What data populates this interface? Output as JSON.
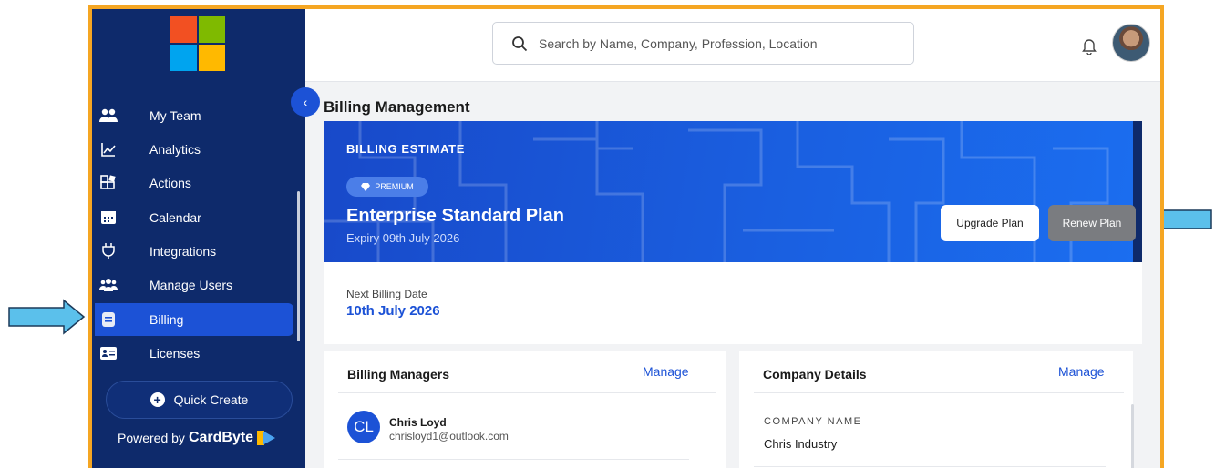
{
  "sidebar": {
    "items": [
      {
        "label": "My Team",
        "icon": "team-icon"
      },
      {
        "label": "Analytics",
        "icon": "analytics-icon"
      },
      {
        "label": "Actions",
        "icon": "actions-icon"
      },
      {
        "label": "Calendar",
        "icon": "calendar-icon"
      },
      {
        "label": "Integrations",
        "icon": "plug-icon"
      },
      {
        "label": "Manage Users",
        "icon": "users-icon"
      },
      {
        "label": "Billing",
        "icon": "billing-icon",
        "active": true
      },
      {
        "label": "Licenses",
        "icon": "license-icon"
      }
    ],
    "quick_create": "Quick Create",
    "powered_prefix": "Powered by",
    "powered_brand": "CardByte"
  },
  "header": {
    "search_placeholder": "Search by Name, Company, Profession, Location"
  },
  "page": {
    "title": "Billing Management"
  },
  "banner": {
    "heading": "BILLING ESTIMATE",
    "badge": "PREMIUM",
    "plan_name": "Enterprise Standard Plan",
    "expiry": "Expiry 09th July 2026",
    "upgrade_label": "Upgrade Plan",
    "renew_label": "Renew Plan"
  },
  "next_billing": {
    "label": "Next Billing Date",
    "value": "10th July 2026"
  },
  "billing_managers": {
    "title": "Billing Managers",
    "manage_label": "Manage",
    "managers": [
      {
        "initials": "CL",
        "name": "Chris Loyd",
        "email": "chrisloyd1@outlook.com"
      }
    ]
  },
  "company_details": {
    "title": "Company Details",
    "manage_label": "Manage",
    "company_name_label": "COMPANY NAME",
    "company_name_value": "Chris Industry"
  },
  "colors": {
    "sidebar_bg": "#0e2a6b",
    "accent": "#1c52d6",
    "frame_border": "#f5a623",
    "arrow_fill": "#5bc0eb"
  }
}
